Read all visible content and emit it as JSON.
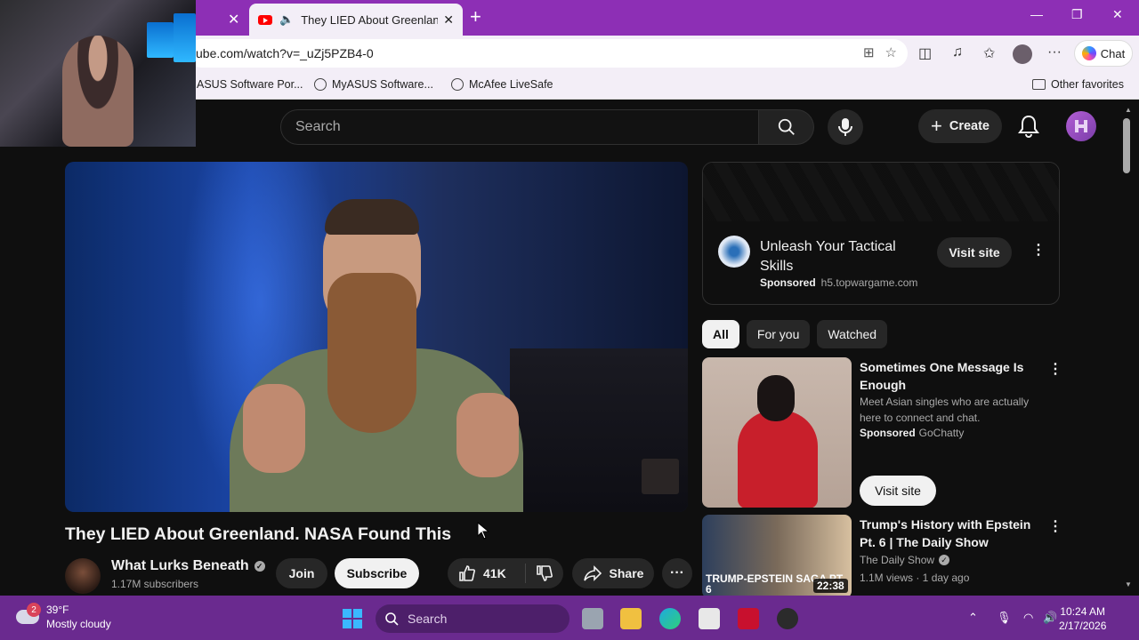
{
  "browser": {
    "active_tab_title": "They LIED About Greenland. N",
    "url": "ube.com/watch?v=_uZj5PZB4-0",
    "chat_label": "Chat",
    "bookmarks": [
      "ASUS Software Por...",
      "MyASUS Software...",
      "McAfee LiveSafe"
    ],
    "other_favorites": "Other favorites"
  },
  "youtube": {
    "search_placeholder": "Search",
    "create_label": "Create",
    "video": {
      "title": "They LIED About Greenland. NASA Found This",
      "channel": "What Lurks Beneath",
      "subscribers": "1.17M subscribers",
      "join_label": "Join",
      "subscribe_label": "Subscribe",
      "likes": "41K",
      "share_label": "Share"
    },
    "ad": {
      "title": "Unleash Your Tactical Skills",
      "sponsored": "Sponsored",
      "domain": "h5.topwargame.com",
      "visit_label": "Visit site"
    },
    "chips": [
      "All",
      "For you",
      "Watched"
    ],
    "recommendations": [
      {
        "title": "Sometimes One Message Is Enough",
        "description": "Meet Asian singles who are actually here to connect and chat.",
        "sponsored": "Sponsored",
        "advertiser": "GoChatty",
        "visit_label": "Visit site"
      },
      {
        "title": "Trump's History with Epstein Pt. 6 | The Daily Show",
        "channel": "The Daily Show",
        "meta": "1.1M views · 1 day ago",
        "duration": "22:38",
        "thumb_text": "TRUMP-EPSTEIN SAGA PT. 6"
      }
    ]
  },
  "taskbar": {
    "weather_temp": "39°F",
    "weather_desc": "Mostly cloudy",
    "weather_badge": "2",
    "search_label": "Search",
    "time": "10:24 AM",
    "date": "2/17/2026"
  }
}
